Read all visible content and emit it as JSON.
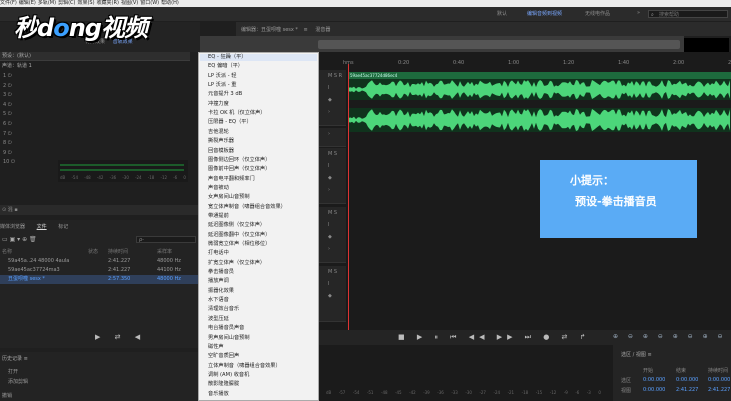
{
  "menubar": [
    "文件(F)",
    "编辑(E)",
    "多轨(M)",
    "剪辑(C)",
    "效果(S)",
    "收藏夹(R)",
    "视图(V)",
    "窗口(W)",
    "帮助(H)"
  ],
  "toolbar": {
    "workspaces": [
      "默认",
      "编辑音频到视频",
      "无线电作品"
    ],
    "active_workspace": "编辑音频到视频",
    "more": "»",
    "search_placeholder": "搜索帮助"
  },
  "logo": {
    "part1": "秒",
    "part2": "d",
    "part3": "o",
    "part4": "ng",
    "part5": "视频"
  },
  "left_panel": {
    "tabs": [
      "特殊效果",
      "音轨效果"
    ],
    "preset_label": "预设：(默认)",
    "channel_label": "声道：轨道 1",
    "slots": [
      "1",
      "2",
      "3",
      "4",
      "5",
      "6",
      "7",
      "8",
      "9",
      "10"
    ],
    "meter_ticks": [
      "dB",
      "-54",
      "-48",
      "-42",
      "-36",
      "-30",
      "-24",
      "-18",
      "-12",
      "-6",
      "0"
    ],
    "strip_label": "⊙ 混 ▪"
  },
  "files": {
    "tabs": [
      "媒体浏览器",
      "文件",
      "标记"
    ],
    "active_tab": "文件",
    "search_placeholder": "ρ-",
    "headers": [
      "名称",
      "状态",
      "持续时间",
      "采样率"
    ],
    "rows": [
      {
        "name": "59a45a..24 48000 4aula",
        "status": "",
        "duration": "2:41.227",
        "rate": "48000 Hz"
      },
      {
        "name": "59ae45ac37724ma3",
        "status": "",
        "duration": "2:41.227",
        "rate": "44100 Hz"
      },
      {
        "name": "丑蛋呗噬 sesx *",
        "status": "",
        "duration": "2:57.350",
        "rate": "48000 Hz"
      }
    ],
    "transport": "▶ ⇄ ◀"
  },
  "history": {
    "title": "历史记录 ≡",
    "items": [
      "打开",
      "添加剪辑"
    ],
    "footer": "撤销"
  },
  "editor": {
    "tabs": [
      "编辑器：丑蛋呗噬 sesx *",
      "≡",
      "混音器"
    ],
    "active_tab": "编辑器：丑蛋呗噬 sesx *",
    "ruler": [
      "hms",
      "0:20",
      "0:40",
      "1:00",
      "1:20",
      "1:40",
      "2:00",
      "2:20"
    ],
    "clip_label": "59ae45ac37724d86ec4",
    "track_controls": [
      "M",
      "S",
      "R",
      "I",
      "◆"
    ]
  },
  "tip": {
    "line1": "小提示：",
    "line2": "预设-拳击播音员"
  },
  "transport": {
    "buttons": "■ ▶ ⏸ ⏮ ◀◀ ▶▶ ⏭ ● ⇄ ↱",
    "zoom": "⊕ ⊖ ⊕ ⊖ ⊕ ⊖ ⊕ ⊖"
  },
  "bottom_ticks": [
    "dB",
    "-57",
    "-54",
    "-51",
    "-48",
    "-45",
    "-42",
    "-39",
    "-36",
    "-33",
    "-30",
    "-27",
    "-24",
    "-21",
    "-18",
    "-15",
    "-12",
    "-9",
    "-6",
    "-3",
    "0"
  ],
  "selection_view": {
    "title": "选区 / 视图 ≡",
    "headers": [
      "开始",
      "结束",
      "持续时间"
    ],
    "selection": {
      "label": "选区",
      "start": "0:00.000",
      "end": "0:00.000",
      "duration": "0:00.000"
    },
    "view": {
      "label": "视图",
      "start": "0:00.000",
      "end": "2:41.227",
      "duration": "2:41.227"
    }
  },
  "dropdown": {
    "items": [
      "EQ - 狂躁（平）",
      "EQ 偏暗（平）",
      "LP 沃派 - 轻",
      "LP 沃派 - 重",
      "元音提升 3 dB",
      "冲撞力度",
      "卡拉 OK 机（仅立体声）",
      "压限器 - EQ（平）",
      "吉他混轮",
      "撕裂声乐器",
      "回音模板器",
      "图像侧边回环（仅立体声）",
      "图像前中回声（仅立体声）",
      "声音电平翻和频率门",
      "声音被动",
      "女声房间山音预制",
      "宽立体声制音（啸器组合音效果）",
      "带通提前",
      "延迟图像侧（仅立体声）",
      "延迟图像翻中（仅立体声）",
      "微弱宽立体声（相位移位）",
      "打电话中",
      "扩宽立体声（仅立体声）",
      "拳击播音员",
      "播放声调",
      "振器化效果",
      "水下语音",
      "清理效台音乐",
      "波型压延",
      "电台播音员声音",
      "男声房间山音预制",
      "磁性声",
      "空旷音质回声",
      "立体声制音（啸器组合音效果）",
      "调制 (AM) 收音机",
      "散影隆隆朦胧",
      "音乐播放"
    ]
  }
}
